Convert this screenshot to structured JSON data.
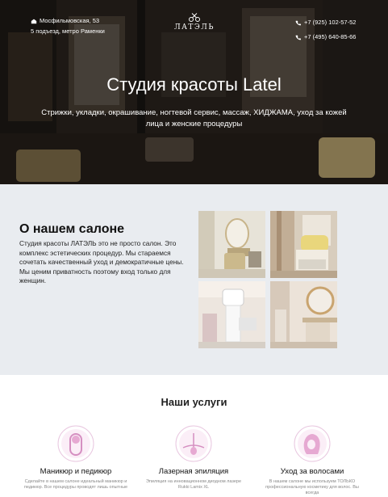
{
  "header": {
    "address_line1": "Мосфильмовская, 53",
    "address_line2": "5 подъезд, метро Раменки",
    "logo_text": "ЛАТЭЛЬ",
    "phone1": "+7 (925) 102-57-52",
    "phone2": "+7 (495) 640-85-66"
  },
  "hero": {
    "title": "Студия красоты Latel",
    "subtitle": "Стрижки, укладки, окрашивание, ногтевой сервис, массаж, ХИДЖАМА, уход за кожей лица и женские процедуры"
  },
  "about": {
    "title": "О нашем салоне",
    "text": "Студия красоты ЛАТЭЛЬ это не просто салон. Это комплекс эстетических процедур. Мы стараемся сочетать качественный уход и демократичные цены. Мы ценим приватность поэтому вход только для женщин."
  },
  "services": {
    "title": "Наши услуги",
    "items": [
      {
        "name": "Маникюр и педикюр",
        "desc": "Сделайте в нашем салоне идеальный маникюр и педикюр. Все процедуры проводят лишь опытные",
        "icon": "nail-icon"
      },
      {
        "name": "Лазерная эпиляция",
        "desc": "Эпиляция на инновационном диодном лазере Rukki Lamix XL",
        "icon": "hair-follicle-icon"
      },
      {
        "name": "Уход за волосами",
        "desc": "В нашем салоне мы используем ТОЛЬКО профессиональную косметику для волос. Вы всегда",
        "icon": "woman-hair-icon"
      }
    ]
  },
  "colors": {
    "about_bg": "#e9ecf0",
    "accent_pink": "#d7a0c8"
  }
}
